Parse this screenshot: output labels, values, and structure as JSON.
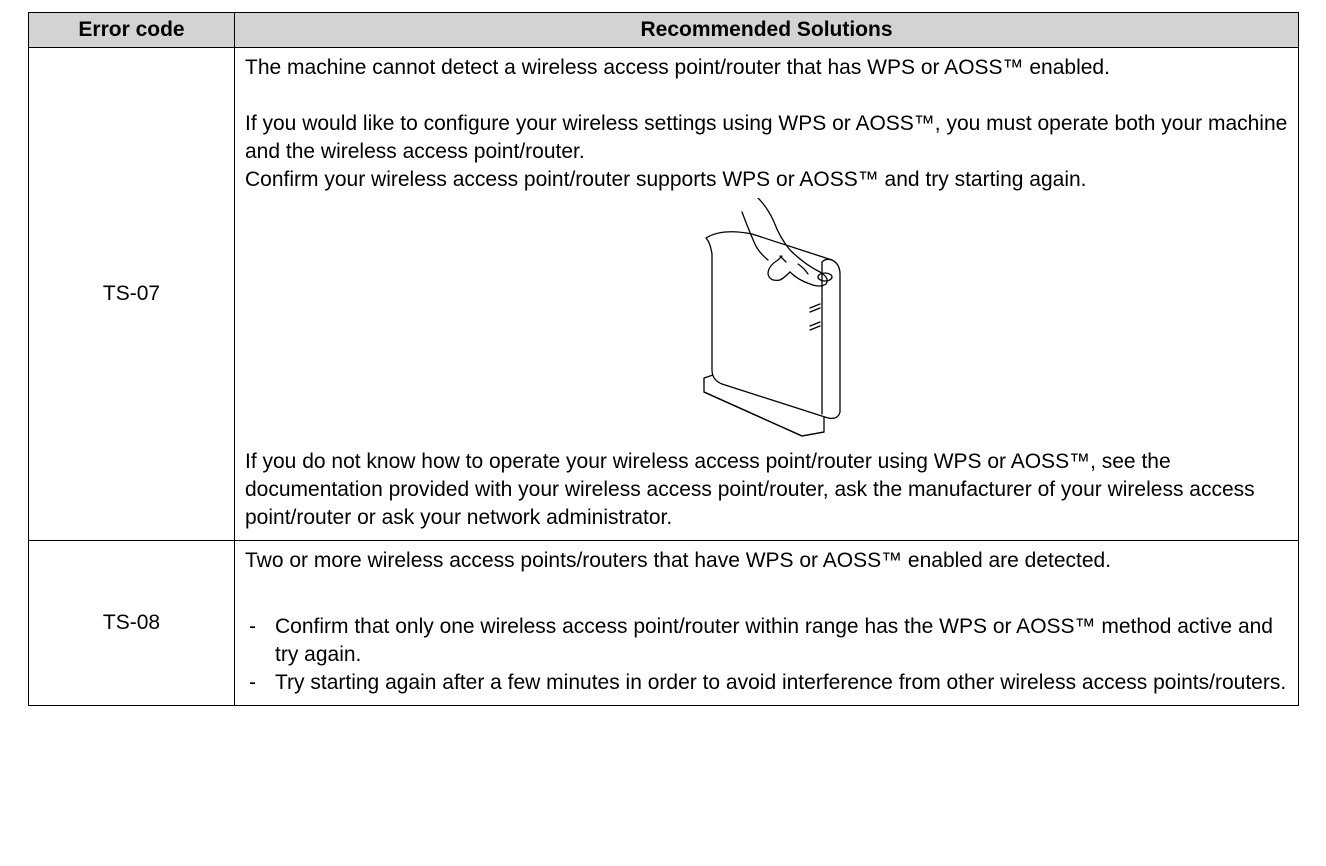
{
  "table": {
    "headers": {
      "code": "Error code",
      "solutions": "Recommended Solutions"
    },
    "rows": [
      {
        "code": "TS-07",
        "p1": "The machine cannot detect a wireless access point/router that has WPS or AOSS™ enabled.",
        "p2": "If you would like to configure your wireless settings using WPS or AOSS™, you must operate both your machine and the wireless access point/router.",
        "p3": "Confirm your wireless access point/router supports WPS or AOSS™ and try starting again.",
        "figure_icon": "router-wps-button-press-icon",
        "p4": "If you do not know how to operate your wireless access point/router using WPS or AOSS™, see the documentation provided with your wireless access point/router, ask the manufacturer of your wireless access point/router or ask your network administrator."
      },
      {
        "code": "TS-08",
        "p1": "Two or more wireless access points/routers that have WPS or AOSS™ enabled are detected.",
        "bullet_mark": "-",
        "bullets": [
          "Confirm that only one wireless access point/router within range has the WPS or AOSS™ method active and try again.",
          "Try starting again after a few minutes in order to avoid interference from other wireless access points/routers."
        ]
      }
    ]
  }
}
